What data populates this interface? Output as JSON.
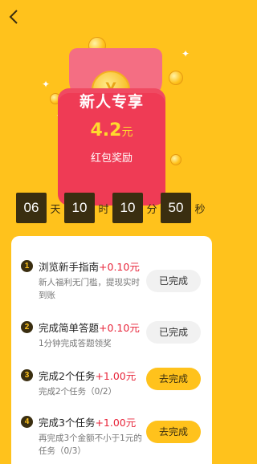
{
  "hero": {
    "title": "新人专享",
    "amount": "4.2",
    "amount_unit": "元",
    "subtitle": "红包奖励",
    "coin_symbol": "¥"
  },
  "countdown": {
    "days": "06",
    "days_unit": "天",
    "hours": "10",
    "hours_unit": "时",
    "minutes": "10",
    "minutes_unit": "分",
    "seconds": "50",
    "seconds_unit": "秒"
  },
  "tasks": [
    {
      "num": "1",
      "title": "浏览新手指南",
      "reward": "+0.10元",
      "desc": "新人福利无门槛，提现实时到账",
      "button": "已完成"
    },
    {
      "num": "2",
      "title": "完成简单答题",
      "reward": "+0.10元",
      "desc": "1分钟完成答题领奖",
      "button": "已完成"
    },
    {
      "num": "3",
      "title": "完成2个任务",
      "reward": "+1.00元",
      "desc": "完成2个任务（0/2）",
      "button": "去完成"
    },
    {
      "num": "4",
      "title": "完成3个任务",
      "reward": "+1.00元",
      "desc": "再完成3个金额不小于1元的任务（0/3）",
      "button": "去完成"
    }
  ],
  "colors": {
    "background": "#FFC21C",
    "envelope": "#EF3B55",
    "accent_red": "#E8253A",
    "dark": "#3A2E10"
  }
}
